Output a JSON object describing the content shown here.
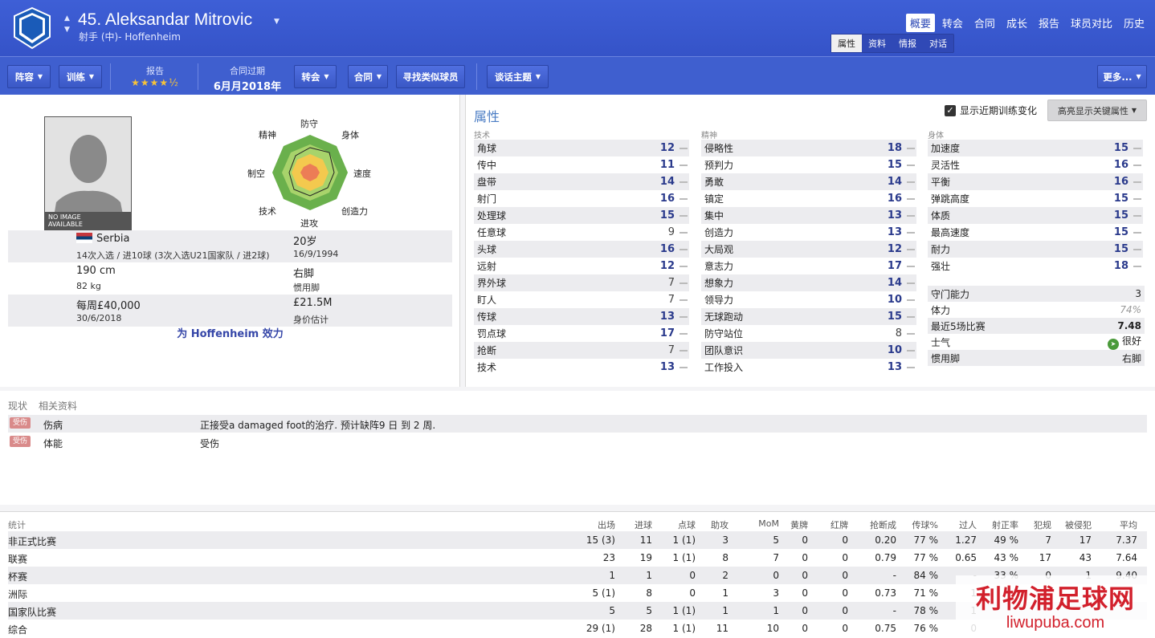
{
  "header": {
    "player_title": "45. Aleksandar Mitrovic",
    "subtitle": "射手 (中)- Hoffenheim",
    "nav": [
      "概要",
      "转会",
      "合同",
      "成长",
      "报告",
      "球员对比",
      "历史"
    ],
    "subnav": [
      "属性",
      "资料",
      "情报",
      "对话"
    ]
  },
  "toolbar": {
    "squad": "阵容",
    "training": "训练",
    "report_label": "报告",
    "report_stars": "★★★★½",
    "contract_label": "合同过期",
    "contract_value": "6月月2018年",
    "transfer": "转会",
    "contract": "合同",
    "find_similar": "寻找类似球员",
    "talk": "谈话主题",
    "more": "更多..."
  },
  "profile": {
    "no_image": "NO IMAGE",
    "available": "AVAILABLE",
    "radar_labels": {
      "top": "防守",
      "top_right": "身体",
      "right": "速度",
      "bottom_right": "创造力",
      "bottom": "进攻",
      "bottom_left": "技术",
      "left": "制空",
      "top_left": "精神"
    },
    "nation": "Serbia",
    "caps": "14次入选 / 进10球 (3次入选U21国家队 / 进2球)",
    "age": "20岁",
    "dob": "16/9/1994",
    "height": "190 cm",
    "weight": "82 kg",
    "foot": "右脚",
    "foot_label": "惯用脚",
    "wage": "每周£40,000",
    "wage_expiry": "30/6/2018",
    "value": "£21.5M",
    "value_label": "身价估计",
    "plays_for": "为 Hoffenheim 效力"
  },
  "attributes": {
    "title": "属性",
    "toggle_label": "显示近期训练变化",
    "highlight_btn": "高亮显示关键属性",
    "technical_title": "技术",
    "mental_title": "精神",
    "physical_title": "身体",
    "technical": [
      [
        "角球",
        "12"
      ],
      [
        "传中",
        "11"
      ],
      [
        "盘带",
        "14"
      ],
      [
        "射门",
        "16"
      ],
      [
        "处理球",
        "15"
      ],
      [
        "任意球",
        "9"
      ],
      [
        "头球",
        "16"
      ],
      [
        "远射",
        "12"
      ],
      [
        "界外球",
        "7"
      ],
      [
        "盯人",
        "7"
      ],
      [
        "传球",
        "13"
      ],
      [
        "罚点球",
        "17"
      ],
      [
        "抢断",
        "7"
      ],
      [
        "技术",
        "13"
      ]
    ],
    "mental": [
      [
        "侵略性",
        "18"
      ],
      [
        "预判力",
        "15"
      ],
      [
        "勇敢",
        "14"
      ],
      [
        "镇定",
        "16"
      ],
      [
        "集中",
        "13"
      ],
      [
        "创造力",
        "13"
      ],
      [
        "大局观",
        "12"
      ],
      [
        "意志力",
        "17"
      ],
      [
        "想象力",
        "14"
      ],
      [
        "领导力",
        "10"
      ],
      [
        "无球跑动",
        "15"
      ],
      [
        "防守站位",
        "8"
      ],
      [
        "团队意识",
        "10"
      ],
      [
        "工作投入",
        "13"
      ]
    ],
    "physical": [
      [
        "加速度",
        "15"
      ],
      [
        "灵活性",
        "16"
      ],
      [
        "平衡",
        "16"
      ],
      [
        "弹跳高度",
        "15"
      ],
      [
        "体质",
        "15"
      ],
      [
        "最高速度",
        "15"
      ],
      [
        "耐力",
        "15"
      ],
      [
        "强壮",
        "18"
      ]
    ],
    "extra": [
      [
        "守门能力",
        "3"
      ],
      [
        "体力",
        "74%"
      ],
      [
        "最近5场比赛",
        "7.48"
      ],
      [
        "士气",
        "很好"
      ],
      [
        "惯用脚",
        "右脚"
      ]
    ]
  },
  "status": {
    "tab1": "现状",
    "tab2": "相关资料",
    "badge": "受伤",
    "rows": [
      [
        "伤病",
        "正接受a damaged foot的治疗. 预计缺阵9 日 到 2 周."
      ],
      [
        "体能",
        "受伤"
      ]
    ]
  },
  "stats": {
    "title": "统计",
    "headers": [
      "出场",
      "进球",
      "点球",
      "助攻",
      "MoM",
      "黄牌",
      "红牌",
      "抢断成",
      "传球%",
      "过人",
      "射正率",
      "犯规",
      "被侵犯",
      "平均"
    ],
    "rows": [
      [
        "非正式比赛",
        "15 (3)",
        "11",
        "1 (1)",
        "3",
        "5",
        "0",
        "0",
        "0.20",
        "77 %",
        "1.27",
        "49 %",
        "7",
        "17",
        "7.37"
      ],
      [
        "联赛",
        "23",
        "19",
        "1 (1)",
        "8",
        "7",
        "0",
        "0",
        "0.79",
        "77 %",
        "0.65",
        "43 %",
        "17",
        "43",
        "7.64"
      ],
      [
        "杯赛",
        "1",
        "1",
        "0",
        "2",
        "0",
        "0",
        "0",
        "-",
        "84 %",
        "-",
        "33 %",
        "0",
        "1",
        "9.40"
      ],
      [
        "洲际",
        "5 (1)",
        "8",
        "0",
        "1",
        "3",
        "0",
        "0",
        "0.73",
        "71 %",
        "1",
        "",
        "",
        "",
        ""
      ],
      [
        "国家队比赛",
        "5",
        "5",
        "1 (1)",
        "1",
        "1",
        "0",
        "0",
        "-",
        "78 %",
        "1",
        "",
        "",
        "",
        ""
      ],
      [
        "综合",
        "29 (1)",
        "28",
        "1 (1)",
        "11",
        "10",
        "0",
        "0",
        "0.75",
        "76 %",
        "0",
        "",
        "",
        "",
        ""
      ]
    ]
  },
  "watermark": {
    "cn": "利物浦足球网",
    "url": "liwupuba.com"
  },
  "colors": {
    "header": "#3e5fd6",
    "accent": "#2a3a8c",
    "injury": "#d98a8a"
  }
}
